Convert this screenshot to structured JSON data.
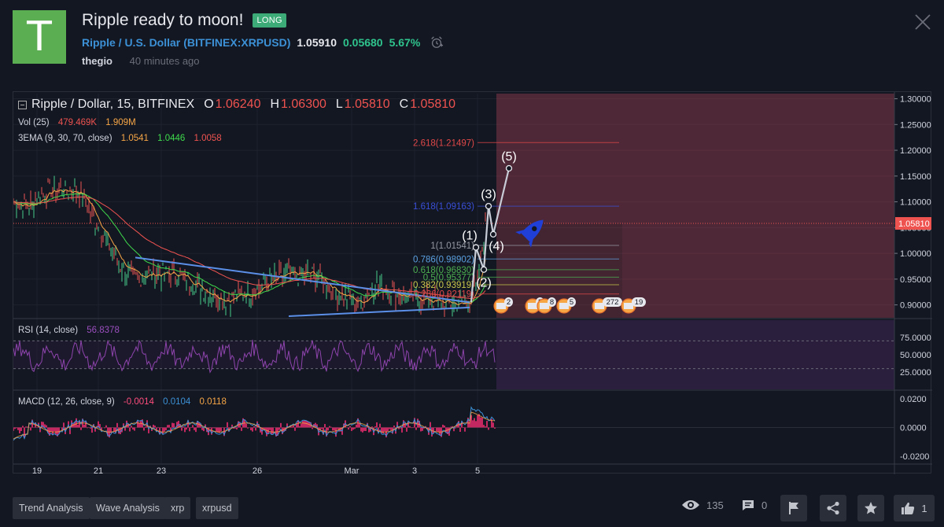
{
  "idea": {
    "avatar_letter": "T",
    "title": "Ripple ready to moon!",
    "badge": "LONG",
    "symbol_name": "Ripple / U.S. Dollar",
    "symbol_exchange": "(BITFINEX:XRPUSD)",
    "price": "1.05910",
    "change": "0.05680",
    "change_pct": "5.67%",
    "author": "thegio",
    "posted": "40 minutes ago",
    "icons": {
      "alarm": "alarm-clock-icon",
      "close": "close-icon"
    }
  },
  "legend": {
    "main_title": "Ripple / Dollar, 15, BITFINEX",
    "ohlc": [
      {
        "k": "O",
        "v": "1.06240"
      },
      {
        "k": "H",
        "v": "1.06300"
      },
      {
        "k": "L",
        "v": "1.05810"
      },
      {
        "k": "C",
        "v": "1.05810"
      }
    ],
    "vol_label": "Vol (25)",
    "vol_v1": "479.469K",
    "vol_v2": "1.909M",
    "ema_label": "3EMA (9, 30, 70, close)",
    "ema_v1": "1.0541",
    "ema_v2": "1.0446",
    "ema_v3": "1.0058",
    "rsi_label": "RSI (14, close)",
    "rsi_v": "56.8378",
    "macd_label": "MACD (12, 26, close, 9)",
    "macd_v1": "-0.0014",
    "macd_v2": "0.0104",
    "macd_v3": "0.0118"
  },
  "chart_data": {
    "type": "line",
    "symbol": "XRPUSD",
    "interval": "15",
    "price_axis_ticks": [
      "1.30000",
      "1.25000",
      "1.20000",
      "1.15000",
      "1.10000",
      "1.05000",
      "1.00000",
      "0.95000",
      "0.90000"
    ],
    "last_price_label": "1.05810",
    "ylim": [
      0.875,
      1.31
    ],
    "x_tick_labels": [
      "19",
      "21",
      "23",
      "26",
      "Mar",
      "3",
      "5"
    ],
    "rsi_ticks": [
      "75.0000",
      "50.0000",
      "25.0000"
    ],
    "macd_ticks": [
      "0.0200",
      "0.0000",
      "-0.0200"
    ],
    "fib_levels": [
      {
        "label": "2.618(1.21497)",
        "value": 1.21497,
        "color": "#e04848"
      },
      {
        "label": "1.618(1.09163)",
        "value": 1.09163,
        "color": "#3a4fd8"
      },
      {
        "label": "1(1.01541)",
        "value": 1.01541,
        "color": "#9598a1"
      },
      {
        "label": "0.786(0.98902)",
        "value": 0.98902,
        "color": "#5aa0e0"
      },
      {
        "label": "0.618(0.96830)",
        "value": 0.9683,
        "color": "#4cb050"
      },
      {
        "label": "0.5(0.95377)",
        "value": 0.95377,
        "color": "#4cb050"
      },
      {
        "label": "0.382(0.93919)",
        "value": 0.93919,
        "color": "#c8c84a"
      },
      {
        "label": "0.236(0.92119)",
        "value": 0.92119,
        "color": "#e04848"
      }
    ],
    "wave_labels": [
      "(1)",
      "(2)",
      "(3)",
      "(4)",
      "(5)"
    ],
    "wave_points": [
      {
        "label": "(1)",
        "price": 1.0115
      },
      {
        "label": "(2)",
        "price": 0.9685
      },
      {
        "label": "(3)",
        "price": 1.0916
      },
      {
        "label": "(4)",
        "price": 1.037
      },
      {
        "label": "(5)",
        "price": 1.165
      }
    ],
    "event_counts": [
      "2",
      "2",
      "8",
      "5",
      "272",
      "19"
    ]
  },
  "tags": [
    "Trend Analysis",
    "Wave Analysis",
    "xrp",
    "xrpusd"
  ],
  "stats": {
    "views": "135",
    "comments": "0",
    "likes": "1"
  },
  "icons": {
    "views": "eye-icon",
    "comments": "comment-icon",
    "flag": "flag-icon",
    "share": "share-icon",
    "favorite": "star-icon",
    "like": "thumbs-up-icon",
    "rocket": "rocket-icon"
  }
}
